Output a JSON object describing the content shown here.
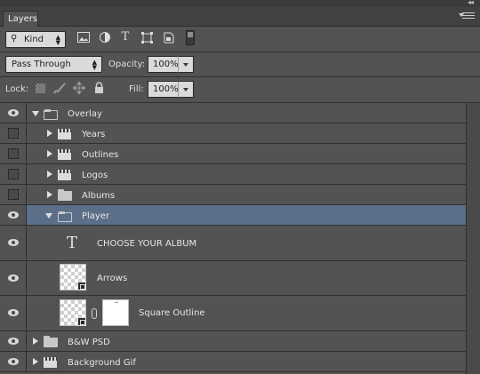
{
  "panel": {
    "tab_label": "Layers",
    "collapse_glyph": "◂◂",
    "menu_icon": "panel-menu-icon"
  },
  "filter": {
    "kind_label": "Kind",
    "icons": [
      "search-icon",
      "pixel-filter-icon",
      "adjustment-filter-icon",
      "type-filter-icon",
      "shape-filter-icon",
      "smart-object-filter-icon",
      "filter-toggle-icon"
    ],
    "type_glyph": "T"
  },
  "blend": {
    "mode": "Pass Through",
    "opacity_label": "Opacity:",
    "opacity_value": "100%"
  },
  "lock": {
    "label": "Lock:",
    "fill_label": "Fill:",
    "fill_value": "100%",
    "icons": [
      "lock-transparency-icon",
      "lock-paint-icon",
      "lock-position-icon",
      "lock-all-icon"
    ]
  },
  "layers": [
    {
      "name": "Overlay",
      "kind": "group",
      "expanded": true,
      "visible": true,
      "depth": 0
    },
    {
      "name": "Years",
      "kind": "video-group",
      "expanded": false,
      "visible": false,
      "depth": 1
    },
    {
      "name": "Outlines",
      "kind": "video-group",
      "expanded": false,
      "visible": false,
      "depth": 1
    },
    {
      "name": "Logos",
      "kind": "video-group",
      "expanded": false,
      "visible": false,
      "depth": 1
    },
    {
      "name": "Albums",
      "kind": "group",
      "expanded": false,
      "visible": false,
      "depth": 1
    },
    {
      "name": "Player",
      "kind": "group",
      "expanded": true,
      "visible": true,
      "depth": 1,
      "selected": true
    },
    {
      "name": "CHOOSE YOUR ALBUM",
      "kind": "text",
      "visible": true,
      "depth": 2,
      "glyph": "T"
    },
    {
      "name": "Arrows",
      "kind": "smart-object",
      "visible": true,
      "depth": 2
    },
    {
      "name": "Square Outline",
      "kind": "smart-object-masked",
      "visible": true,
      "depth": 2
    },
    {
      "name": "B&W PSD",
      "kind": "group",
      "expanded": false,
      "visible": true,
      "depth": 0
    },
    {
      "name": "Background Gif",
      "kind": "video-group",
      "expanded": false,
      "visible": true,
      "depth": 0
    }
  ],
  "colors": {
    "panel_bg": "#535353",
    "selected_row": "#5c6f88"
  }
}
